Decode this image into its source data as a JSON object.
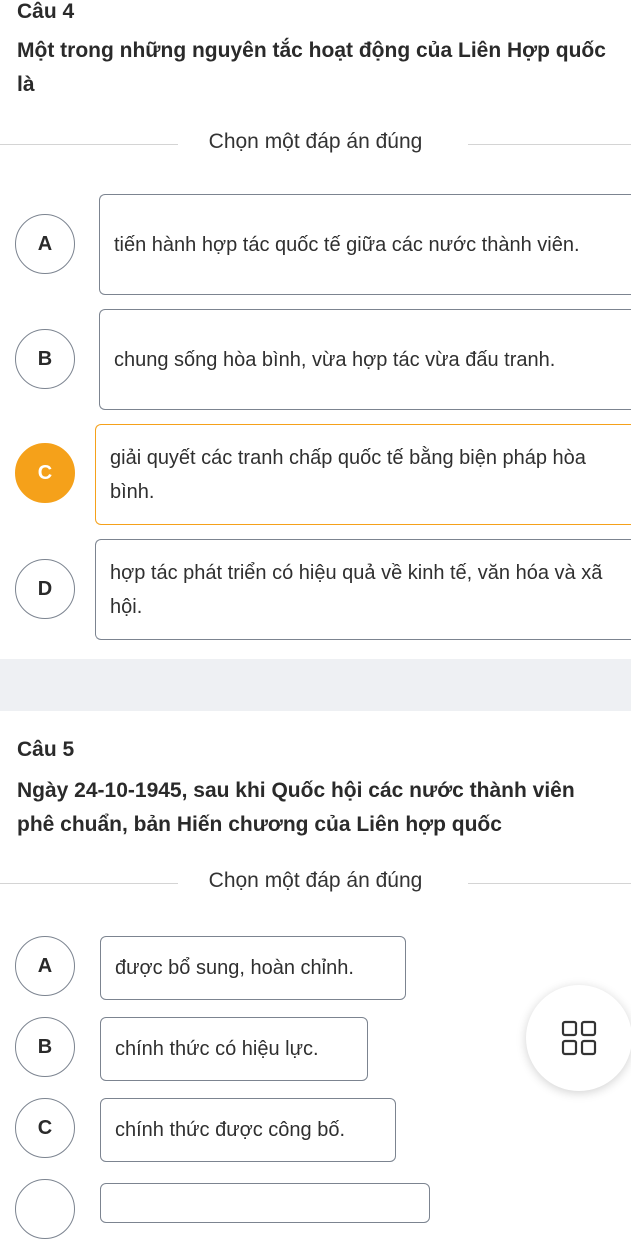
{
  "questions": [
    {
      "label": "Câu 4",
      "text": "Một trong những nguyên tắc hoạt động của Liên Hợp quốc là",
      "instruction": "Chọn một đáp án đúng",
      "options": [
        {
          "letter": "A",
          "text": "tiến hành hợp tác quốc tế giữa các nước thành viên."
        },
        {
          "letter": "B",
          "text": "chung sống hòa bình, vừa hợp tác vừa đấu tranh."
        },
        {
          "letter": "C",
          "text": "giải quyết các tranh chấp quốc tế bằng biện pháp hòa bình."
        },
        {
          "letter": "D",
          "text": "hợp tác phát triển có hiệu quả về kinh tế, văn hóa và xã hội."
        }
      ],
      "selected": "C"
    },
    {
      "label": "Câu 5",
      "text": "Ngày 24-10-1945, sau khi Quốc hội các nước thành viên phê chuẩn, bản Hiến chương của Liên hợp quốc",
      "instruction": "Chọn một đáp án đúng",
      "options": [
        {
          "letter": "A",
          "text": "được bổ sung, hoàn chỉnh."
        },
        {
          "letter": "B",
          "text": "chính thức có hiệu lực."
        },
        {
          "letter": "C",
          "text": "chính thức được công bố."
        }
      ]
    }
  ],
  "fab": {
    "icon": "grid-menu-icon"
  },
  "colors": {
    "accent": "#f5a11a",
    "border": "#7c8490",
    "band": "#eef0f3"
  }
}
